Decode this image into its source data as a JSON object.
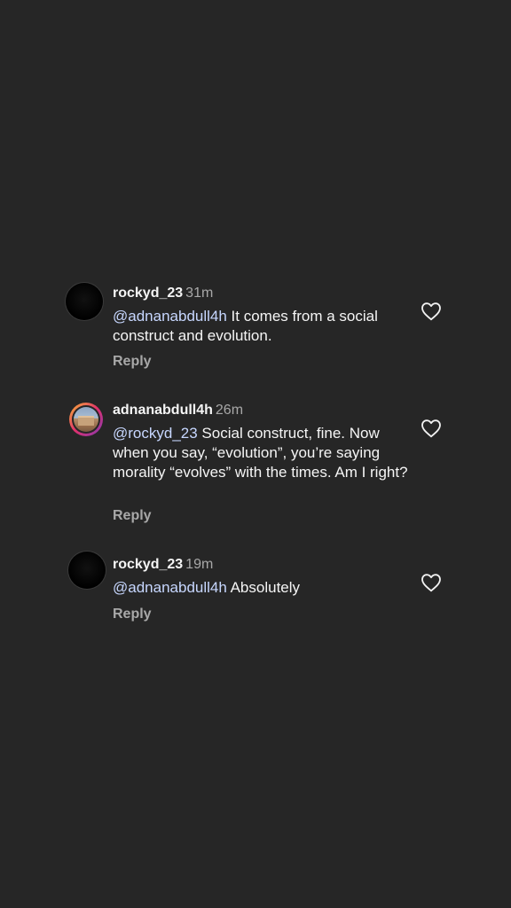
{
  "comments": [
    {
      "username": "rockyd_23",
      "time": "31m",
      "mention": "@adnanabdull4h",
      "body": " It comes from a social construct and evolution.",
      "reply_label": "Reply"
    },
    {
      "username": "adnanabdull4h",
      "time": "26m",
      "mention": "@rockyd_23",
      "body": " Social construct, fine. Now when you say, “evolution”, you’re saying morality “evolves” with the times. Am I right?",
      "reply_label": "Reply"
    },
    {
      "username": "rockyd_23",
      "time": "19m",
      "mention": "@adnanabdull4h",
      "body": " Absolutely",
      "reply_label": "Reply"
    }
  ],
  "colors": {
    "background": "#262626",
    "mention": "#c7d7ff",
    "secondary_text": "#a8a8a8"
  },
  "icons": {
    "like": "heart-outline-icon"
  }
}
